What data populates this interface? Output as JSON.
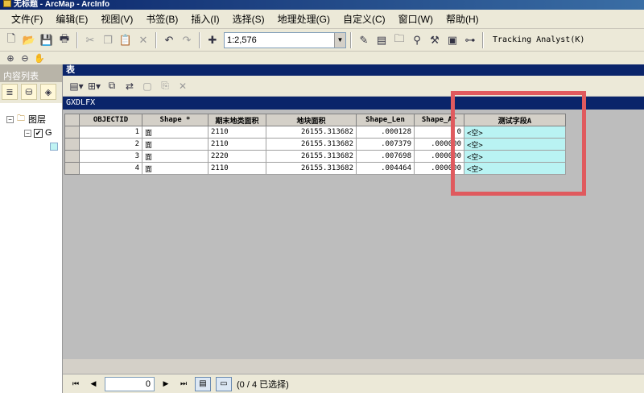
{
  "window": {
    "title": "无标题 - ArcMap - ArcInfo"
  },
  "menu": [
    "文件(F)",
    "编辑(E)",
    "视图(V)",
    "书签(B)",
    "插入(I)",
    "选择(S)",
    "地理处理(G)",
    "自定义(C)",
    "窗口(W)",
    "帮助(H)"
  ],
  "toolbar": {
    "scale": "1:2,576",
    "tracking_label": "Tracking Analyst(K)"
  },
  "toc": {
    "title": "内容列表",
    "layers_label": "图层",
    "layer_abbrev": "G"
  },
  "table_window": {
    "title": "表",
    "tab_name": "GXDLFX",
    "columns": [
      "OBJECTID",
      "Shape *",
      "期末地类面积",
      "地块面积",
      "Shape_Len",
      "Shape_Ar",
      "测试字段A"
    ],
    "rows": [
      [
        "1",
        "面",
        "2110",
        "26155.313682",
        ".000128",
        "0",
        "<空>"
      ],
      [
        "2",
        "面",
        "2110",
        "26155.313682",
        ".007379",
        ".000000",
        "<空>"
      ],
      [
        "3",
        "面",
        "2220",
        "26155.313682",
        ".007698",
        ".000000",
        "<空>"
      ],
      [
        "4",
        "面",
        "2110",
        "26155.313682",
        ".004464",
        ".000000",
        "<空>"
      ]
    ],
    "status": {
      "current_record": "0",
      "selection_text": "(0 / 4 已选择)"
    }
  },
  "colors": {
    "highlight_box": "#e05a5e",
    "new_field_fill": "#b9f3f3",
    "title_blue": "#0a246a"
  },
  "icons": [
    "new-icon",
    "open-icon",
    "save-icon",
    "print-icon",
    "cut-icon",
    "copy-icon",
    "paste-icon",
    "delete-icon",
    "undo-icon",
    "redo-icon",
    "add-data-icon",
    "zoom-in-icon",
    "zoom-out-icon",
    "pan-icon"
  ]
}
